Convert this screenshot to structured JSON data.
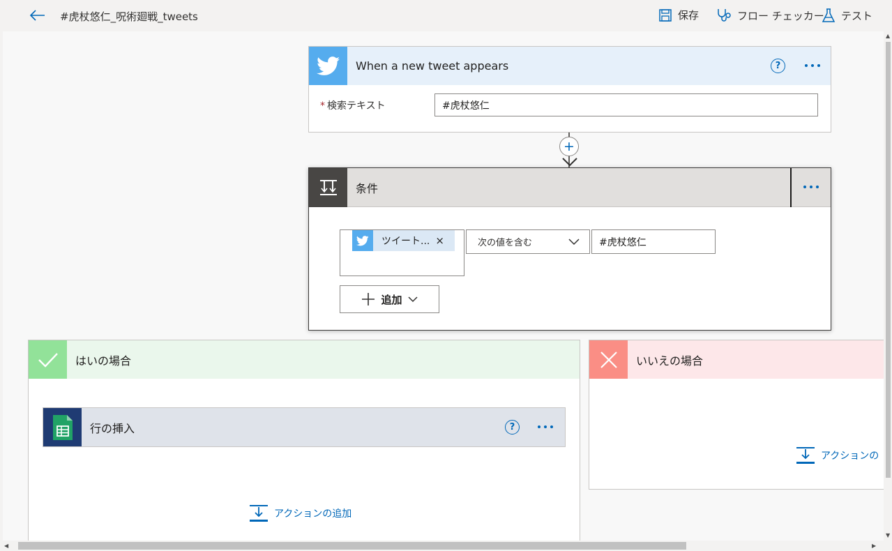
{
  "header": {
    "title": "#虎杖悠仁_呪術廻戦_tweets",
    "save_label": "保存",
    "checker_label": "フロー チェッカー",
    "test_label": "テスト"
  },
  "trigger": {
    "title": "When a new tweet appears",
    "help": "?",
    "field_label": "検索テキスト",
    "required_mark": "*",
    "field_value": "#虎杖悠仁",
    "icon": "twitter-icon",
    "color": "#55acee"
  },
  "connector": {
    "plus": "+"
  },
  "condition": {
    "title": "条件",
    "token_text": "ツイート...",
    "token_remove": "×",
    "operator": "次の値を含む",
    "value": "#虎杖悠仁",
    "add_label": "追加",
    "icon": "condition-icon",
    "color": "#484644"
  },
  "yes_branch": {
    "title": "はいの場合",
    "color": "#92e299",
    "action": {
      "title": "行の挿入",
      "help": "?",
      "icon": "google-sheets-icon",
      "color": "#21a366"
    },
    "add_action_label": "アクションの追加"
  },
  "no_branch": {
    "title": "いいえの場合",
    "color": "#fa8e85",
    "add_action_label": "アクションの"
  }
}
